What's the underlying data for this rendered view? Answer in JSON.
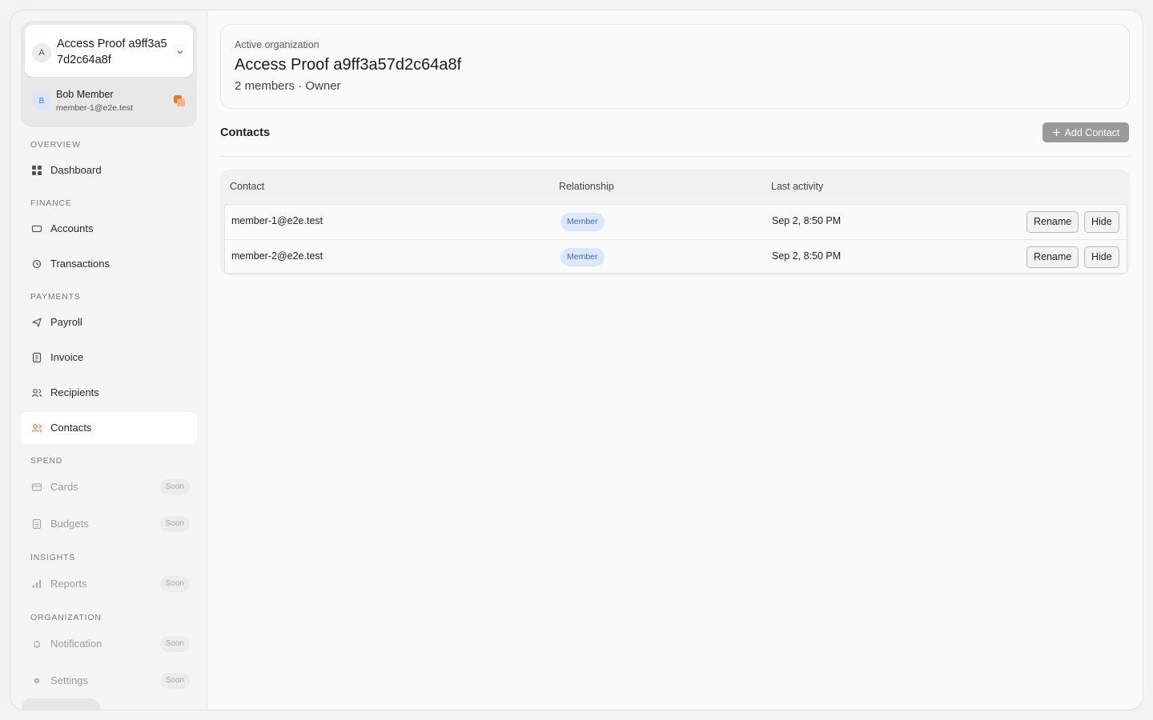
{
  "sidebar": {
    "org": {
      "avatar": "A",
      "name": "Access Proof a9ff3a57d2c64a8f",
      "chevron_icon": "chevron-down-icon"
    },
    "user": {
      "avatar": "B",
      "name": "Bob Member",
      "email": "member-1@e2e.test",
      "badge_icon": "switch-account-icon"
    },
    "sections": {
      "overview": "OVERVIEW",
      "finance": "FINANCE",
      "payments": "PAYMENTS",
      "spend": "SPEND",
      "insights": "INSIGHTS",
      "organization": "ORGANIZATION"
    },
    "items": {
      "dashboard": "Dashboard",
      "accounts": "Accounts",
      "transactions": "Transactions",
      "payroll": "Payroll",
      "invoice": "Invoice",
      "recipients": "Recipients",
      "contacts": "Contacts",
      "cards": "Cards",
      "budgets": "Budgets",
      "reports": "Reports",
      "notification": "Notification",
      "settings": "Settings"
    },
    "soon_label": "Soon",
    "accent_color": "#e8742f"
  },
  "header": {
    "kicker": "Active organization",
    "title": "Access Proof a9ff3a57d2c64a8f",
    "subtitle": "2 members · Owner"
  },
  "contacts": {
    "title": "Contacts",
    "add_label": "Add Contact",
    "columns": {
      "contact": "Contact",
      "relationship": "Relationship",
      "last_activity": "Last activity"
    },
    "rows": [
      {
        "contact": "member-1@e2e.test",
        "relationship": "Member",
        "last_activity": "Sep 2, 8:50 PM",
        "rename": "Rename",
        "hide": "Hide"
      },
      {
        "contact": "member-2@e2e.test",
        "relationship": "Member",
        "last_activity": "Sep 2, 8:50 PM",
        "rename": "Rename",
        "hide": "Hide"
      }
    ]
  }
}
